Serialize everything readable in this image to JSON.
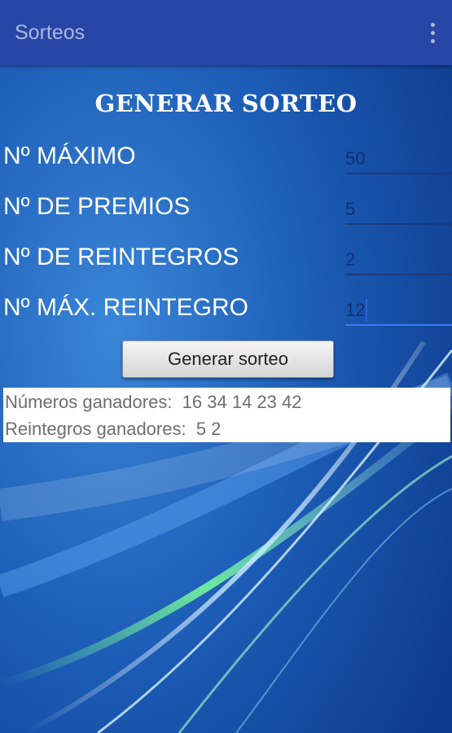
{
  "app_bar": {
    "title": "Sorteos",
    "overflow_icon": "more-vert-icon"
  },
  "form": {
    "heading": "GENERAR SORTEO",
    "fields": [
      {
        "label": "Nº MÁXIMO",
        "value": "50"
      },
      {
        "label": "Nº DE PREMIOS",
        "value": "5"
      },
      {
        "label": "Nº DE REINTEGROS",
        "value": "2"
      },
      {
        "label": "Nº MÁX. REINTEGRO",
        "value": "12"
      }
    ],
    "button_label": "Generar sorteo"
  },
  "results": {
    "winning_numbers": "Números ganadores:  16 34 14 23 42",
    "winning_refunds": "Reintegros ganadores:  5 2"
  },
  "colors": {
    "app_bar": "#2746a6",
    "background": "#1c5cb6",
    "text_primary": "#ffffff"
  }
}
